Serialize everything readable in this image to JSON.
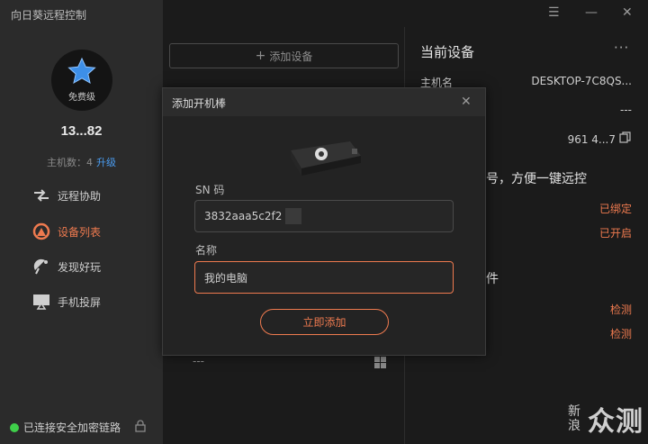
{
  "app": {
    "title": "向日葵远程控制"
  },
  "user": {
    "tier": "免费级",
    "id_masked": "13...82",
    "host_count_label": "主机数：4",
    "upgrade_label": "升级"
  },
  "nav": {
    "items": [
      {
        "label": "远程协助",
        "icon": "remote-assist-icon",
        "active": false
      },
      {
        "label": "设备列表",
        "icon": "device-list-icon",
        "active": true
      },
      {
        "label": "发现好玩",
        "icon": "discover-icon",
        "active": false
      },
      {
        "label": "手机投屏",
        "icon": "screen-cast-icon",
        "active": false
      }
    ]
  },
  "status": {
    "connection": "已连接安全加密链路"
  },
  "window": {
    "menu_glyph": "☰",
    "minimize_glyph": "—",
    "close_glyph": "✕"
  },
  "devices": {
    "add_button": "添加设备",
    "row_value": "---"
  },
  "current_device": {
    "title": "当前设备",
    "more_glyph": "···",
    "hostname_label": "主机名",
    "hostname_value": "DESKTOP-7C8QS...",
    "row2_value": "---",
    "row3_value": "961 4...7",
    "bind_text": "号，方便一键远控",
    "bound_status": "已绑定",
    "enabled_status": "已开启",
    "section_text": "件",
    "check_1": "检测",
    "check_2": "检测"
  },
  "dialog": {
    "title": "添加开机棒",
    "close_glyph": "✕",
    "sn_label": "SN 码",
    "sn_value": "3832aaa5c2f2",
    "name_label": "名称",
    "name_value": "我的电脑",
    "submit_label": "立即添加"
  },
  "watermark": {
    "left_chars": "新浪",
    "right_chars": "众测"
  },
  "colors": {
    "accent": "#ee7a4f",
    "link": "#4a9cf0",
    "status_ok": "#3fcf4a",
    "star": "#3d8fe8"
  }
}
